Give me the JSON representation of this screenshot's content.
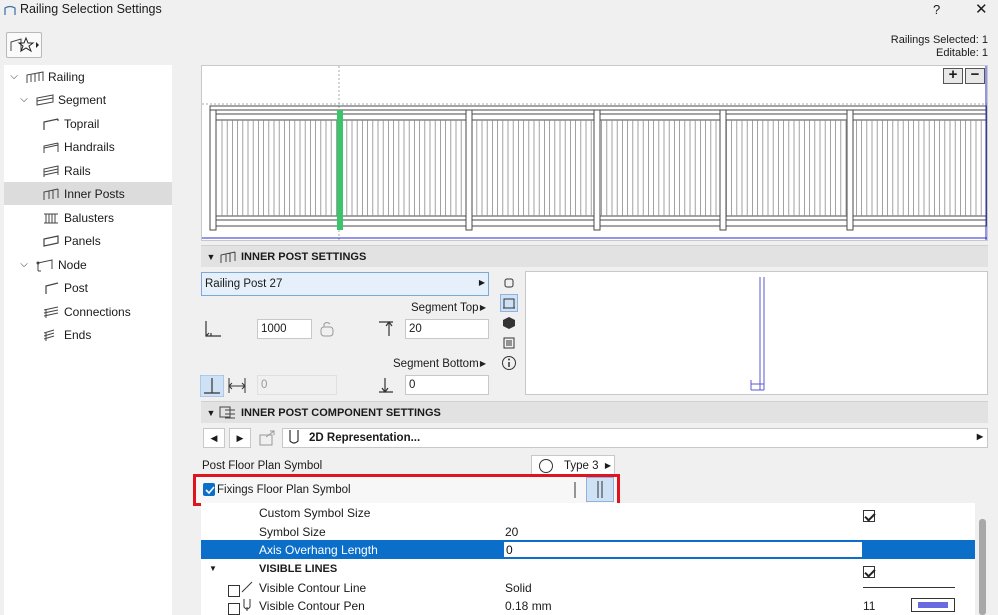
{
  "window": {
    "title": "Railing Selection Settings",
    "help_label": "?",
    "close_label": "✕"
  },
  "selection": {
    "railings_selected": "Railings Selected: 1",
    "editable": "Editable: 1"
  },
  "tree": {
    "items": [
      {
        "label": "Railing",
        "icon": "railing-icon",
        "level": 0,
        "expanded": true
      },
      {
        "label": "Segment",
        "icon": "segment-icon",
        "level": 1,
        "expanded": true
      },
      {
        "label": "Toprail",
        "icon": "toprail-icon",
        "level": 2
      },
      {
        "label": "Handrails",
        "icon": "handrails-icon",
        "level": 2
      },
      {
        "label": "Rails",
        "icon": "rails-icon",
        "level": 2
      },
      {
        "label": "Inner Posts",
        "icon": "inner-posts-icon",
        "level": 2,
        "selected": true
      },
      {
        "label": "Balusters",
        "icon": "balusters-icon",
        "level": 2
      },
      {
        "label": "Panels",
        "icon": "panels-icon",
        "level": 2
      },
      {
        "label": "Node",
        "icon": "node-icon",
        "level": 1,
        "expanded": true
      },
      {
        "label": "Post",
        "icon": "post-icon",
        "level": 2
      },
      {
        "label": "Connections",
        "icon": "connections-icon",
        "level": 2
      },
      {
        "label": "Ends",
        "icon": "ends-icon",
        "level": 2
      }
    ]
  },
  "preview": {
    "zoom_in": "+",
    "zoom_out": "−"
  },
  "inner_post_settings": {
    "header": "INNER POST SETTINGS",
    "post_name": "Railing Post 27",
    "segment_top_label": "Segment Top",
    "segment_top_value": "20",
    "height_value": "1000",
    "segment_bottom_label": "Segment Bottom",
    "segment_bottom_value": "0",
    "offset_value": "0"
  },
  "component_settings": {
    "header": "INNER POST COMPONENT SETTINGS",
    "representation": "2D Representation...",
    "floor_plan_symbol_label": "Post Floor Plan Symbol",
    "floor_plan_symbol_value": "Type 3",
    "fixings_label": "Fixings Floor Plan Symbol",
    "fixings_checked": true
  },
  "settings_table": {
    "rows": [
      {
        "label": "Custom Symbol Size",
        "value": "",
        "checked": true
      },
      {
        "label": "Symbol Size",
        "value": "20"
      },
      {
        "label": "Axis Overhang Length",
        "value": "0",
        "selected": true
      },
      {
        "label": "VISIBLE LINES",
        "group": true,
        "checked": true
      },
      {
        "label": "Visible Contour Line",
        "value": "Solid"
      },
      {
        "label": "Visible Contour Pen",
        "value": "0.18 mm",
        "pen": "11"
      }
    ]
  },
  "colors": {
    "accent": "#0b6fc9",
    "highlight_box": "#e0141e",
    "selected_post": "#3cc46a"
  }
}
